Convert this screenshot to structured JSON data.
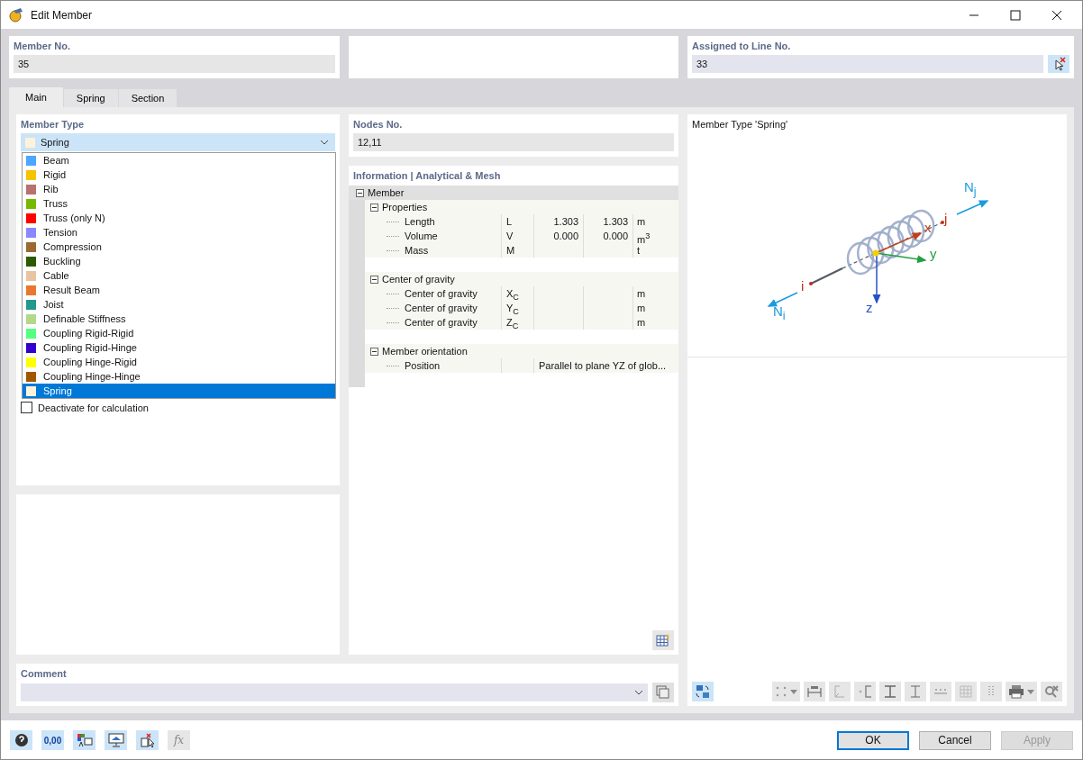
{
  "window": {
    "title": "Edit Member"
  },
  "member_no": {
    "label": "Member No.",
    "value": "35"
  },
  "assigned_line": {
    "label": "Assigned to Line No.",
    "value": "33"
  },
  "tabs": [
    {
      "label": "Main",
      "selected": true
    },
    {
      "label": "Spring",
      "selected": false
    },
    {
      "label": "Section",
      "selected": false
    }
  ],
  "member_type": {
    "label": "Member Type",
    "value": "Spring",
    "color": "#fdf3dc",
    "expanded": true,
    "options": [
      {
        "label": "Beam",
        "color": "#4da6ff",
        "selected": false
      },
      {
        "label": "Rigid",
        "color": "#f5c400",
        "selected": false
      },
      {
        "label": "Rib",
        "color": "#b87070",
        "selected": false
      },
      {
        "label": "Truss",
        "color": "#76b900",
        "selected": false
      },
      {
        "label": "Truss (only N)",
        "color": "#ff0000",
        "selected": false
      },
      {
        "label": "Tension",
        "color": "#8888ff",
        "selected": false
      },
      {
        "label": "Compression",
        "color": "#9a6a30",
        "selected": false
      },
      {
        "label": "Buckling",
        "color": "#2d5a00",
        "selected": false
      },
      {
        "label": "Cable",
        "color": "#e8c4a0",
        "selected": false
      },
      {
        "label": "Result Beam",
        "color": "#e87830",
        "selected": false
      },
      {
        "label": "Joist",
        "color": "#22998a",
        "selected": false
      },
      {
        "label": "Definable Stiffness",
        "color": "#b4d88a",
        "selected": false
      },
      {
        "label": "Coupling Rigid-Rigid",
        "color": "#55ff80",
        "selected": false
      },
      {
        "label": "Coupling Rigid-Hinge",
        "color": "#3300cc",
        "selected": false
      },
      {
        "label": "Coupling Hinge-Rigid",
        "color": "#ffff00",
        "selected": false
      },
      {
        "label": "Coupling Hinge-Hinge",
        "color": "#a05800",
        "selected": false
      },
      {
        "label": "Spring",
        "color": "#fdf3dc",
        "selected": true
      }
    ]
  },
  "deactivate": {
    "label": "Deactivate for calculation",
    "checked": false
  },
  "nodes": {
    "label": "Nodes No.",
    "value": "12,11"
  },
  "info": {
    "title": "Information | Analytical & Mesh",
    "tree": [
      {
        "label": "Member",
        "expanded": true,
        "children": [
          {
            "label": "Properties",
            "expanded": true,
            "children": [
              {
                "label": "Length",
                "symbol": "L",
                "value_1": "1.303",
                "value_2": "1.303",
                "unit": "m"
              },
              {
                "label": "Volume",
                "symbol": "V",
                "value_1": "0.000",
                "value_2": "0.000",
                "unit": "m$^{3}$"
              },
              {
                "label": "Mass",
                "symbol": "M",
                "unit": "t"
              }
            ]
          },
          {
            "label": "Center of gravity",
            "expanded": true,
            "children": [
              {
                "label": "Center of gravity",
                "symbol": "X$_{C}$",
                "unit": "m"
              },
              {
                "label": "Center of gravity",
                "symbol": "Y$_{C}$",
                "unit": "m"
              },
              {
                "label": "Center of gravity",
                "symbol": "Z$_{C}$",
                "unit": "m"
              }
            ]
          },
          {
            "label": "Member orientation",
            "expanded": true,
            "children": [
              {
                "label": "Position",
                "wide_value": "Parallel to plane YZ of glob..."
              }
            ]
          }
        ]
      }
    ]
  },
  "preview": {
    "title": "Member Type 'Spring'",
    "labels": [
      {
        "text": "N$_{j}$",
        "kind": "force"
      },
      {
        "text": "j",
        "kind": "node"
      },
      {
        "text": "x",
        "kind": "axis-x"
      },
      {
        "text": "y",
        "kind": "axis-y"
      },
      {
        "text": "z",
        "kind": "axis-z"
      },
      {
        "text": "i",
        "kind": "node"
      },
      {
        "text": "N$_{i}$",
        "kind": "force"
      }
    ],
    "tools": [
      {
        "kind": "sync",
        "on": true
      },
      {
        "kind": "nodes",
        "on": false,
        "dropdown": true
      },
      {
        "kind": "dimension",
        "on": false
      },
      {
        "kind": "axes",
        "on": false
      },
      {
        "kind": "section-c",
        "on": false
      },
      {
        "kind": "i-beam",
        "on": false
      },
      {
        "kind": "i-beam-thin",
        "on": false
      },
      {
        "kind": "numbering",
        "on": false
      },
      {
        "kind": "grid",
        "on": false
      },
      {
        "kind": "dotted",
        "on": false
      },
      {
        "kind": "print",
        "on": false,
        "dropdown": true
      },
      {
        "kind": "zoom-reset",
        "on": false
      }
    ]
  },
  "comment": {
    "label": "Comment"
  },
  "bottom_tools": [
    {
      "kind": "help",
      "disabled": false
    },
    {
      "kind": "decimals",
      "label": "0,00",
      "disabled": false
    },
    {
      "kind": "legend",
      "disabled": false
    },
    {
      "kind": "display",
      "disabled": false
    },
    {
      "kind": "delete-select",
      "disabled": false
    },
    {
      "kind": "formula",
      "label": "fx",
      "disabled": true
    }
  ],
  "buttons": [
    {
      "label": "OK",
      "default": true,
      "disabled": false
    },
    {
      "label": "Cancel",
      "default": false,
      "disabled": false
    },
    {
      "label": "Apply",
      "default": false,
      "disabled": true
    }
  ]
}
